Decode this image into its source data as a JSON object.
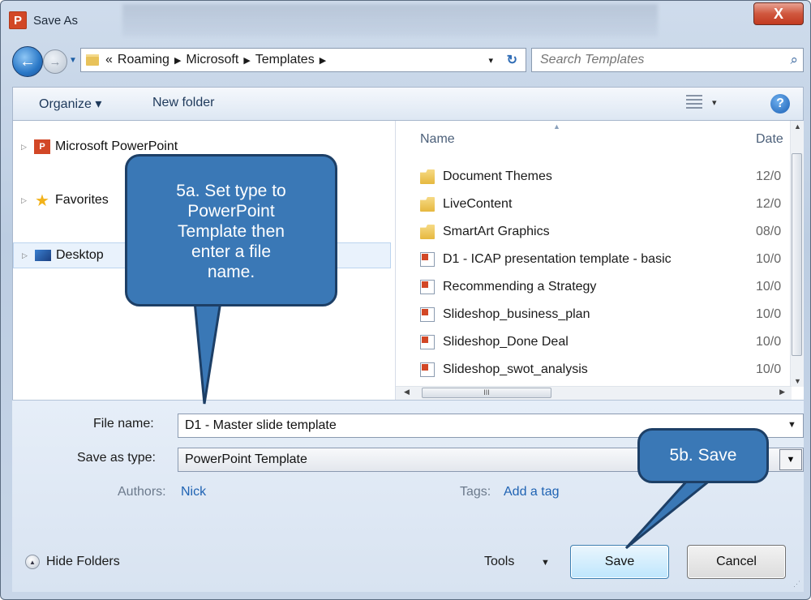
{
  "window": {
    "title": "Save As",
    "app_icon_letter": "P",
    "close_symbol": "X"
  },
  "address_bar": {
    "crumbs": [
      "«",
      "Roaming",
      "Microsoft",
      "Templates"
    ],
    "sep": "▶",
    "dropdown": "▾",
    "refresh": "↻"
  },
  "search": {
    "placeholder": "Search Templates",
    "icon": "search-icon"
  },
  "toolbar": {
    "organize_label": "Organize ▾",
    "new_folder_label": "New folder",
    "view_dropdown": "▾",
    "help_symbol": "?"
  },
  "nav_tree": [
    {
      "label": "Microsoft PowerPoint",
      "icon": "powerpoint-icon",
      "selected": false
    },
    {
      "label": "Favorites",
      "icon": "star-icon",
      "selected": false
    },
    {
      "label": "Desktop",
      "icon": "desktop-icon",
      "selected": true
    }
  ],
  "file_list": {
    "columns": {
      "name": "Name",
      "date": "Date"
    },
    "rows": [
      {
        "name": "Document Themes",
        "type": "folder",
        "date": "12/0"
      },
      {
        "name": "LiveContent",
        "type": "folder",
        "date": "12/0"
      },
      {
        "name": "SmartArt Graphics",
        "type": "folder",
        "date": "08/0"
      },
      {
        "name": "D1 - ICAP presentation template - basic",
        "type": "ppt",
        "date": "10/0"
      },
      {
        "name": "Recommending a Strategy",
        "type": "ppt",
        "date": "10/0"
      },
      {
        "name": "Slideshop_business_plan",
        "type": "ppt",
        "date": "10/0"
      },
      {
        "name": "Slideshop_Done Deal",
        "type": "ppt",
        "date": "10/0"
      },
      {
        "name": "Slideshop_swot_analysis",
        "type": "ppt",
        "date": "10/0"
      }
    ],
    "scroll_grip": "III"
  },
  "form": {
    "file_name_label": "File name:",
    "file_name_value": "D1 - Master slide template",
    "save_type_label": "Save as type:",
    "save_type_value": "PowerPoint Template",
    "authors_label": "Authors:",
    "authors_value": "Nick",
    "tags_label": "Tags:",
    "tags_value": "Add a tag"
  },
  "footer": {
    "hide_folders_label": "Hide Folders",
    "tools_label": "Tools",
    "save_label": "Save",
    "cancel_label": "Cancel"
  },
  "callouts": {
    "a": [
      "5a. Set type to",
      "PowerPoint",
      "Template then",
      "enter a file",
      "name."
    ],
    "b": "5b. Save"
  },
  "colors": {
    "callout_fill": "#3a78b6",
    "callout_border": "#1d3f66",
    "link_blue": "#1f63b3",
    "close_red": "#c33a20"
  }
}
